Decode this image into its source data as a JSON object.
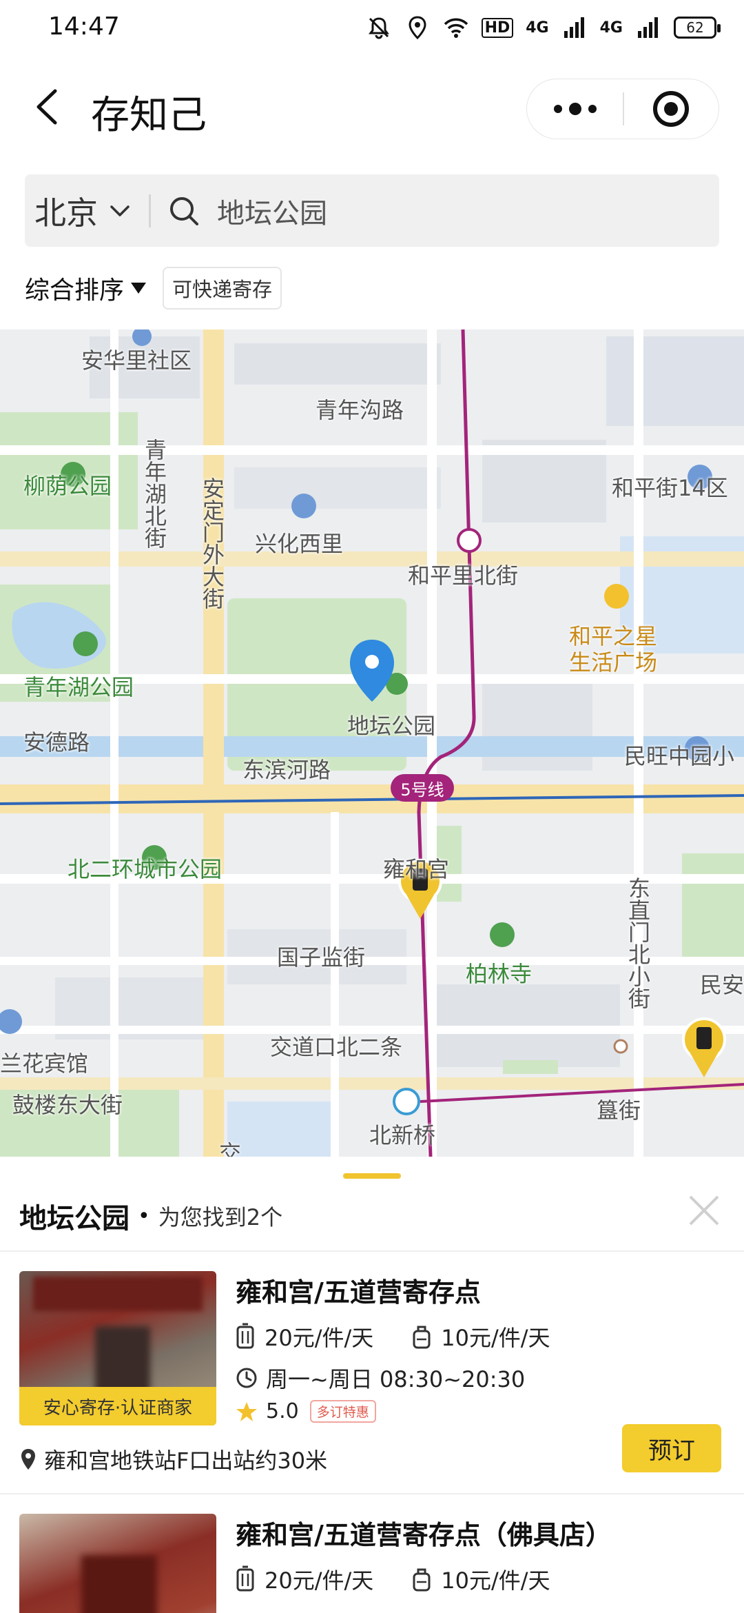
{
  "status_bar": {
    "time": "14:47",
    "hd": "HD",
    "net1": "4G",
    "net2": "4G",
    "battery": "62"
  },
  "header": {
    "title": "存知己"
  },
  "search": {
    "city": "北京",
    "query": "地坛公园"
  },
  "filters": {
    "sort_label": "综合排序",
    "chip_label": "可快递寄存"
  },
  "map": {
    "labels": {
      "anhuali": "安华里社区",
      "qingniangou": "青年沟路",
      "liuyin": "柳荫公园",
      "qingnianhu_bei": "青年湖北街",
      "anding": "安定门外大街",
      "xinghua": "兴化西里",
      "hepingjie14": "和平街14区",
      "hepinglibei": "和平里北街",
      "hepingstar": "和平之星",
      "hepingstar2": "生活广场",
      "qingnianhu": "青年湖公园",
      "ditan": "地坛公园",
      "andelu": "安德路",
      "minwang": "民旺中园小",
      "dongbinhe": "东滨河路",
      "line5": "5号线",
      "beierhuan": "北二环城市公园",
      "yonghegong": "雍和宫",
      "dongzhimen": "东直门北小街",
      "guozijian": "国子监街",
      "bailinsi": "柏林寺",
      "minan": "民安",
      "jiaodaokou": "交道口北二条",
      "huabin": "兰花宾馆",
      "gulou": "鼓楼东大街",
      "beixinqiao": "北新桥",
      "guijie": "簋街",
      "jiao": "交"
    }
  },
  "results": {
    "place": "地坛公园",
    "dot": "•",
    "found_text": "为您找到2个",
    "items": [
      {
        "name": "雍和宫/五道营寄存点",
        "badge": "安心寄存·认证商家",
        "price_large": "20元/件/天",
        "price_small": "10元/件/天",
        "hours": "周一~周日 08:30~20:30",
        "rating": "5.0",
        "promo": "多订特惠",
        "location": "雍和宫地铁站F口出站约30米",
        "book_label": "预订"
      },
      {
        "name": "雍和宫/五道营寄存点（佛具店）",
        "price_large": "20元/件/天",
        "price_small": "10元/件/天"
      }
    ]
  },
  "colors": {
    "accent": "#f3cc2d",
    "metro_line5": "#a3247a",
    "park_green": "#cfe6c4",
    "water": "#b8d6f0"
  }
}
